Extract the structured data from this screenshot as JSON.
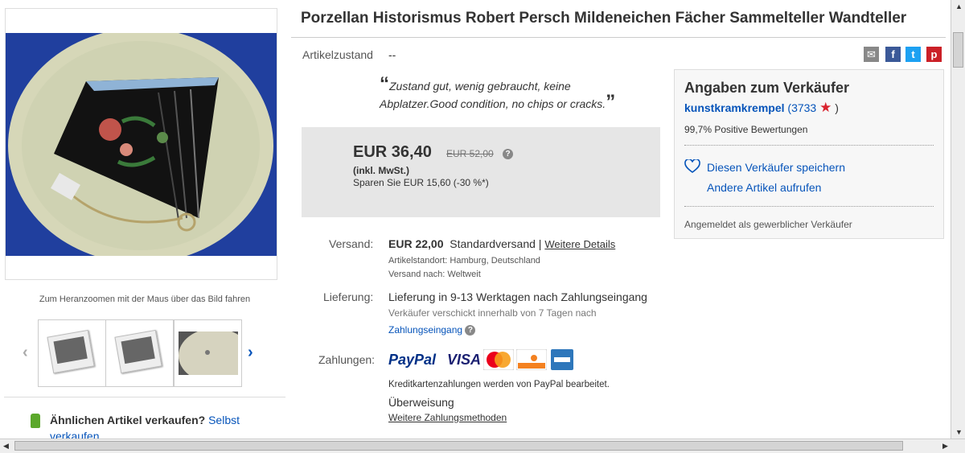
{
  "title": "Porzellan Historismus Robert Persch Mildeneichen Fächer Sammelteller Wandteller",
  "gallery": {
    "zoom_hint": "Zum Heranzoomen mit der Maus über das Bild fahren",
    "prev_icon": "chevron-left-icon",
    "next_icon": "chevron-right-icon"
  },
  "sell_similar": {
    "label": "Ähnlichen Artikel verkaufen?",
    "link": "Selbst verkaufen"
  },
  "condition": {
    "label": "Artikelzustand",
    "value": "--",
    "quote": "Zustand gut, wenig gebraucht, keine Abplatzer.Good condition, no chips or cracks.",
    "open_quote": "“",
    "close_quote": "”"
  },
  "share": [
    "email-icon",
    "facebook-icon",
    "twitter-icon",
    "pinterest-icon"
  ],
  "price": {
    "current": "EUR 36,40",
    "old": "EUR 52,00",
    "vat": "(inkl. MwSt.)",
    "save": "Sparen Sie EUR 15,60 (-30 %*)"
  },
  "shipping": {
    "label": "Versand:",
    "cost": "EUR 22,00",
    "method": "Standardversand",
    "separator": "|",
    "details_link": "Weitere Details",
    "location": "Artikelstandort:  Hamburg, Deutschland",
    "ships_to": "Versand nach:  Weltweit"
  },
  "delivery": {
    "label": "Lieferung:",
    "value": "Lieferung in 9-13 Werktagen nach Zahlungseingang",
    "note1": "Verkäufer verschickt innerhalb von 7 Tagen nach",
    "note2": "Zahlungseingang"
  },
  "payment": {
    "label": "Zahlungen:",
    "paypal": "PayPal",
    "visa": "VISA",
    "note": "Kreditkartenzahlungen werden von PayPal bearbeitet.",
    "transfer": "Überweisung",
    "more_link": "Weitere Zahlungsmethoden"
  },
  "seller": {
    "heading": "Angaben zum Verkäufer",
    "name": "kunstkramkrempel",
    "score": "(3733",
    "score_close": ")",
    "positive": "99,7% Positive Bewertungen",
    "save_link": "Diesen Verkäufer speichern",
    "other_link": "Andere Artikel aufrufen",
    "type": "Angemeldet als gewerblicher Verkäufer"
  },
  "colors": {
    "link": "#0654ba",
    "price_bg": "#e6e6e6",
    "star": "#d9232e"
  }
}
